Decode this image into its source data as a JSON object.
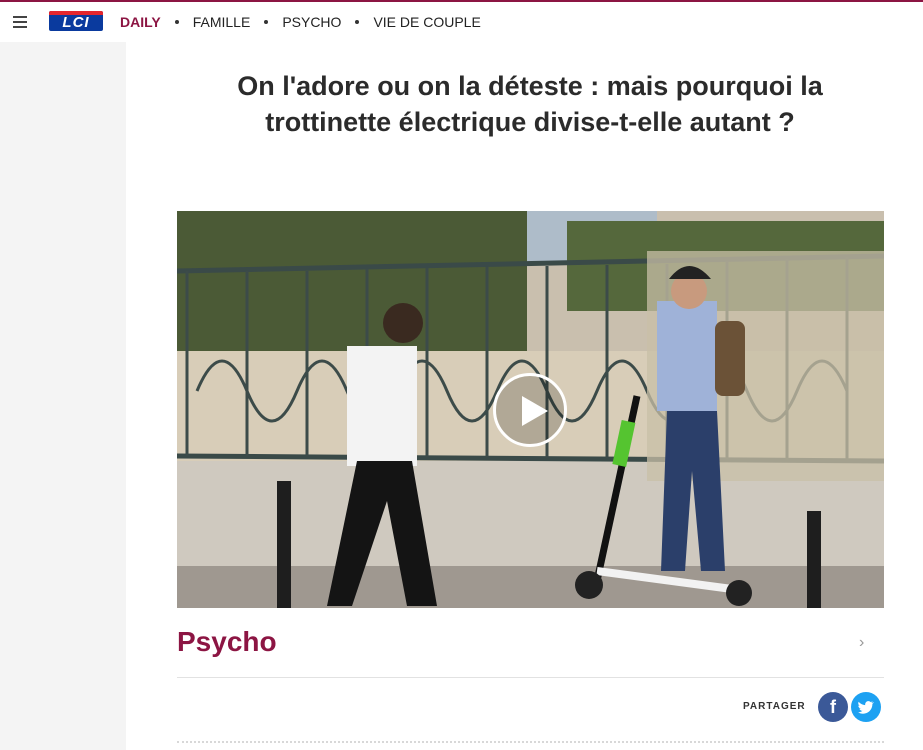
{
  "nav": {
    "menu_icon": "hamburger-icon",
    "logo_text": "LCI",
    "links": [
      {
        "label": "DAILY",
        "active": true
      },
      {
        "label": "FAMILLE",
        "active": false
      },
      {
        "label": "PSYCHO",
        "active": false
      },
      {
        "label": "VIE DE COUPLE",
        "active": false
      }
    ]
  },
  "article": {
    "title": "On l'adore ou on la déteste : mais pourquoi la trottinette électrique divise-t-elle autant ?",
    "video_icon": "play-icon",
    "category": "Psycho",
    "share_label": "PARTAGER",
    "share_networks": [
      "facebook-icon",
      "twitter-icon"
    ],
    "facebook_glyph": "f"
  },
  "colors": {
    "accent": "#8c1543",
    "facebook": "#3b5998",
    "twitter": "#1da1f2",
    "logo_blue": "#0a3a9e",
    "logo_red": "#e4262d"
  }
}
